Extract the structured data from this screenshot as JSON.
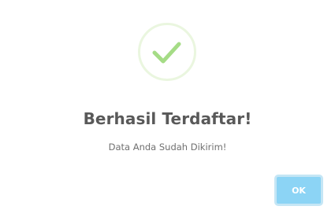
{
  "dialog": {
    "title": "Berhasil Terdaftar!",
    "message": "Data Anda Sudah Dikirim!",
    "ok_label": "OK",
    "icon": "checkmark-success-icon",
    "colors": {
      "check": "#a5dc86",
      "circle_border": "#eaf6df",
      "button": "#8cd4f5",
      "title_text": "#595959"
    }
  }
}
